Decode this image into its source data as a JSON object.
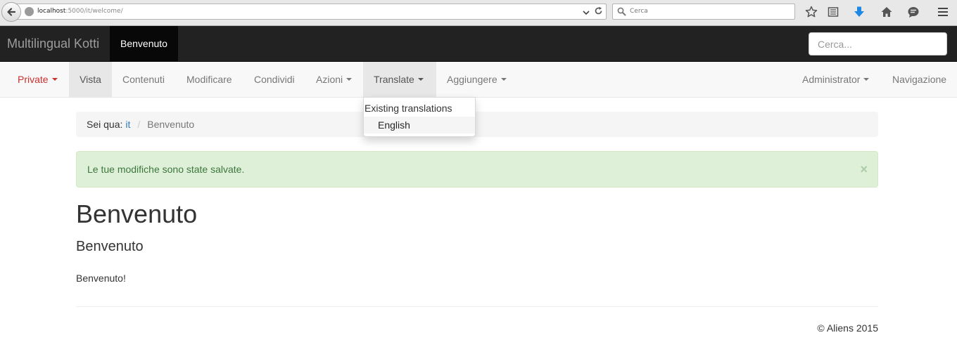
{
  "browser": {
    "url_host": "localhost",
    "url_rest": ":5000/it/welcome/",
    "search_placeholder": "Cerca"
  },
  "navbar": {
    "brand": "Multilingual Kotti",
    "active_item": "Benvenuto",
    "search_placeholder": "Cerca..."
  },
  "editbar": {
    "private": "Private",
    "vista": "Vista",
    "contenuti": "Contenuti",
    "modificare": "Modificare",
    "condividi": "Condividi",
    "azioni": "Azioni",
    "translate": "Translate",
    "aggiungere": "Aggiungere",
    "administrator": "Administrator",
    "navigazione": "Navigazione"
  },
  "translate_menu": {
    "header": "Existing translations",
    "items": [
      "English"
    ]
  },
  "breadcrumb": {
    "prefix": "Sei qua:",
    "link": "it",
    "current": "Benvenuto"
  },
  "alert": {
    "message": "Le tue modifiche sono state salvate.",
    "close": "×"
  },
  "page": {
    "title": "Benvenuto",
    "subtitle": "Benvenuto",
    "body": "Benvenuto!"
  },
  "footer": {
    "text": "© Aliens 2015"
  },
  "colors": {
    "navbar_bg": "#222222",
    "alert_bg": "#dff0d8",
    "link": "#337ab7",
    "private_red": "#c9302c"
  }
}
